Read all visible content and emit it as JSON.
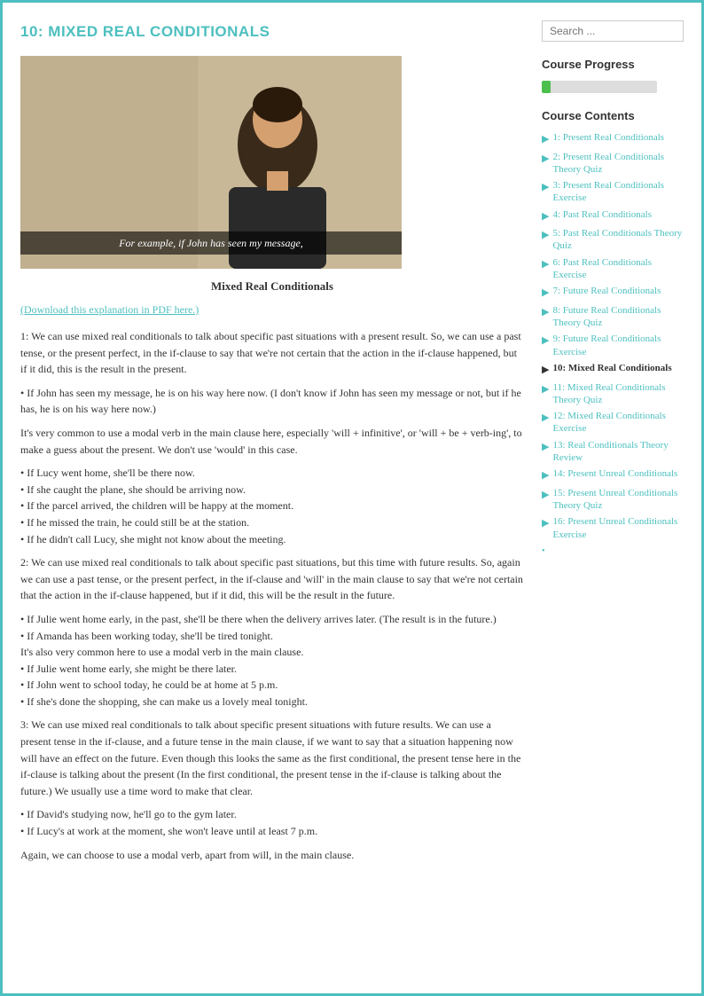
{
  "page": {
    "title": "10: MIXED REAL CONDITIONALS",
    "video_caption": "For example, if John has seen my message,",
    "video_title": "Mixed Real Conditionals",
    "download_link": "(Download this explanation in PDF here.)",
    "lesson_paragraphs": [
      "1: We can use mixed real conditionals to talk about specific past situations with a present result. So, we can use a past tense, or the present perfect, in the if-clause to say that we're not certain that the action in the if-clause happened, but if it did, this is the result in the present.",
      "• If John has seen my message, he is on his way here now. (I don't know if John has seen my message or not, but if he has, he is on his way here now.)",
      "It's very common to use a modal verb in the main clause here, especially 'will + infinitive', or 'will + be + verb-ing', to make a guess about the present. We don't use 'would' in this case.",
      "• If Lucy went home, she'll be there now.\n• If she caught the plane, she should be arriving now.\n• If the parcel arrived, the children will be happy at the moment.\n• If he missed the train, he could still be at the station.\n• If he didn't call Lucy, she might not know about the meeting.",
      "2: We can use mixed real conditionals to talk about specific past situations, but this time with future results. So, again we can use a past tense, or the present perfect, in the if-clause and 'will' in the main clause to say that we're not certain that the action in the if-clause happened, but if it did, this will be the result in the future.",
      "• If Julie went home early, in the past, she'll be there when the delivery arrives later. (The result is in the future.)\n• If Amanda has been working today, she'll be tired tonight.\nIt's also very common here to use a modal verb in the main clause.\n• If Julie went home early, she might be there later.\n• If John went to school today, he could be at home at 5 p.m.\n• If she's done the shopping, she can make us a lovely meal tonight.",
      "3: We can use mixed real conditionals to talk about specific present situations with future results. We can use a present tense in the if-clause, and a future tense in the main clause, if we want to say that a situation happening now will have an effect on the future. Even though this looks the same as the first conditional, the present tense here in the if-clause is talking about the present (In the first conditional, the present tense in the if-clause is talking about the future.) We usually use a time word to make that clear.",
      "• If David's studying now, he'll go to the gym later.\n• If Lucy's at work at the moment, she won't leave until at least 7 p.m.",
      "Again, we can choose to use a modal verb, apart from will, in the main clause."
    ]
  },
  "sidebar": {
    "search_placeholder": "Search ...",
    "progress_title": "Course Progress",
    "progress_percent": 8,
    "contents_title": "Course Contents",
    "items": [
      {
        "label": "1: Present Real Conditionals",
        "active": false
      },
      {
        "label": "2: Present Real Conditionals Theory Quiz",
        "active": false
      },
      {
        "label": "3: Present Real Conditionals Exercise",
        "active": false
      },
      {
        "label": "4: Past Real Conditionals",
        "active": false
      },
      {
        "label": "5: Past Real Conditionals Theory Quiz",
        "active": false
      },
      {
        "label": "6: Past Real Conditionals Exercise",
        "active": false
      },
      {
        "label": "7: Future Real Conditionals",
        "active": false
      },
      {
        "label": "8: Future Real Conditionals Theory Quiz",
        "active": false
      },
      {
        "label": "9: Future Real Conditionals Exercise",
        "active": false
      },
      {
        "label": "10: Mixed Real Conditionals",
        "active": true
      },
      {
        "label": "11: Mixed Real Conditionals Theory Quiz",
        "active": false
      },
      {
        "label": "12: Mixed Real Conditionals Exercise",
        "active": false
      },
      {
        "label": "13: Real Conditionals Theory Review",
        "active": false
      },
      {
        "label": "14: Present Unreal Conditionals",
        "active": false
      },
      {
        "label": "15: Present Unreal Conditionals Theory Quiz",
        "active": false
      },
      {
        "label": "16: Present Unreal Conditionals Exercise",
        "active": false
      }
    ]
  }
}
